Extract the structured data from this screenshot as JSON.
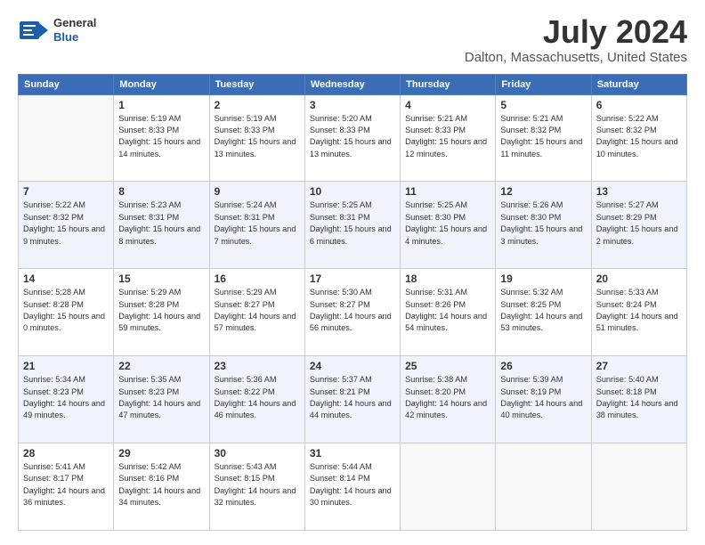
{
  "logo": {
    "general": "General",
    "blue": "Blue"
  },
  "header": {
    "title": "July 2024",
    "subtitle": "Dalton, Massachusetts, United States"
  },
  "days_of_week": [
    "Sunday",
    "Monday",
    "Tuesday",
    "Wednesday",
    "Thursday",
    "Friday",
    "Saturday"
  ],
  "weeks": [
    [
      {
        "day": "",
        "info": ""
      },
      {
        "day": "1",
        "info": "Sunrise: 5:19 AM\nSunset: 8:33 PM\nDaylight: 15 hours\nand 14 minutes."
      },
      {
        "day": "2",
        "info": "Sunrise: 5:19 AM\nSunset: 8:33 PM\nDaylight: 15 hours\nand 13 minutes."
      },
      {
        "day": "3",
        "info": "Sunrise: 5:20 AM\nSunset: 8:33 PM\nDaylight: 15 hours\nand 13 minutes."
      },
      {
        "day": "4",
        "info": "Sunrise: 5:21 AM\nSunset: 8:33 PM\nDaylight: 15 hours\nand 12 minutes."
      },
      {
        "day": "5",
        "info": "Sunrise: 5:21 AM\nSunset: 8:32 PM\nDaylight: 15 hours\nand 11 minutes."
      },
      {
        "day": "6",
        "info": "Sunrise: 5:22 AM\nSunset: 8:32 PM\nDaylight: 15 hours\nand 10 minutes."
      }
    ],
    [
      {
        "day": "7",
        "info": "Sunrise: 5:22 AM\nSunset: 8:32 PM\nDaylight: 15 hours\nand 9 minutes."
      },
      {
        "day": "8",
        "info": "Sunrise: 5:23 AM\nSunset: 8:31 PM\nDaylight: 15 hours\nand 8 minutes."
      },
      {
        "day": "9",
        "info": "Sunrise: 5:24 AM\nSunset: 8:31 PM\nDaylight: 15 hours\nand 7 minutes."
      },
      {
        "day": "10",
        "info": "Sunrise: 5:25 AM\nSunset: 8:31 PM\nDaylight: 15 hours\nand 6 minutes."
      },
      {
        "day": "11",
        "info": "Sunrise: 5:25 AM\nSunset: 8:30 PM\nDaylight: 15 hours\nand 4 minutes."
      },
      {
        "day": "12",
        "info": "Sunrise: 5:26 AM\nSunset: 8:30 PM\nDaylight: 15 hours\nand 3 minutes."
      },
      {
        "day": "13",
        "info": "Sunrise: 5:27 AM\nSunset: 8:29 PM\nDaylight: 15 hours\nand 2 minutes."
      }
    ],
    [
      {
        "day": "14",
        "info": "Sunrise: 5:28 AM\nSunset: 8:28 PM\nDaylight: 15 hours\nand 0 minutes."
      },
      {
        "day": "15",
        "info": "Sunrise: 5:29 AM\nSunset: 8:28 PM\nDaylight: 14 hours\nand 59 minutes."
      },
      {
        "day": "16",
        "info": "Sunrise: 5:29 AM\nSunset: 8:27 PM\nDaylight: 14 hours\nand 57 minutes."
      },
      {
        "day": "17",
        "info": "Sunrise: 5:30 AM\nSunset: 8:27 PM\nDaylight: 14 hours\nand 56 minutes."
      },
      {
        "day": "18",
        "info": "Sunrise: 5:31 AM\nSunset: 8:26 PM\nDaylight: 14 hours\nand 54 minutes."
      },
      {
        "day": "19",
        "info": "Sunrise: 5:32 AM\nSunset: 8:25 PM\nDaylight: 14 hours\nand 53 minutes."
      },
      {
        "day": "20",
        "info": "Sunrise: 5:33 AM\nSunset: 8:24 PM\nDaylight: 14 hours\nand 51 minutes."
      }
    ],
    [
      {
        "day": "21",
        "info": "Sunrise: 5:34 AM\nSunset: 8:23 PM\nDaylight: 14 hours\nand 49 minutes."
      },
      {
        "day": "22",
        "info": "Sunrise: 5:35 AM\nSunset: 8:23 PM\nDaylight: 14 hours\nand 47 minutes."
      },
      {
        "day": "23",
        "info": "Sunrise: 5:36 AM\nSunset: 8:22 PM\nDaylight: 14 hours\nand 46 minutes."
      },
      {
        "day": "24",
        "info": "Sunrise: 5:37 AM\nSunset: 8:21 PM\nDaylight: 14 hours\nand 44 minutes."
      },
      {
        "day": "25",
        "info": "Sunrise: 5:38 AM\nSunset: 8:20 PM\nDaylight: 14 hours\nand 42 minutes."
      },
      {
        "day": "26",
        "info": "Sunrise: 5:39 AM\nSunset: 8:19 PM\nDaylight: 14 hours\nand 40 minutes."
      },
      {
        "day": "27",
        "info": "Sunrise: 5:40 AM\nSunset: 8:18 PM\nDaylight: 14 hours\nand 38 minutes."
      }
    ],
    [
      {
        "day": "28",
        "info": "Sunrise: 5:41 AM\nSunset: 8:17 PM\nDaylight: 14 hours\nand 36 minutes."
      },
      {
        "day": "29",
        "info": "Sunrise: 5:42 AM\nSunset: 8:16 PM\nDaylight: 14 hours\nand 34 minutes."
      },
      {
        "day": "30",
        "info": "Sunrise: 5:43 AM\nSunset: 8:15 PM\nDaylight: 14 hours\nand 32 minutes."
      },
      {
        "day": "31",
        "info": "Sunrise: 5:44 AM\nSunset: 8:14 PM\nDaylight: 14 hours\nand 30 minutes."
      },
      {
        "day": "",
        "info": ""
      },
      {
        "day": "",
        "info": ""
      },
      {
        "day": "",
        "info": ""
      }
    ]
  ]
}
